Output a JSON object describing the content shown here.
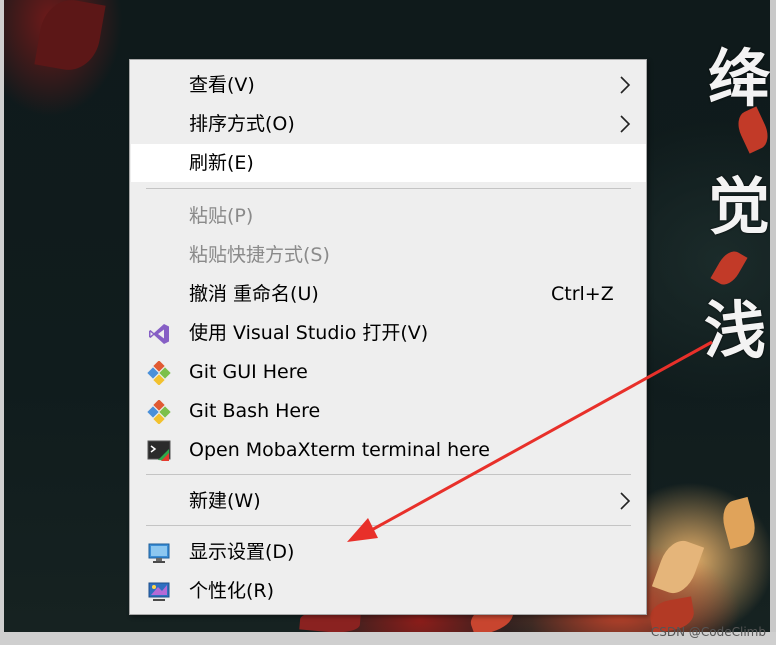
{
  "wallpaper": {
    "characters": [
      "绛",
      "觉",
      "浅"
    ],
    "colors": {
      "dark": "#101c1d",
      "accent_red": "#c4442b",
      "accent_gold": "#e7b16a"
    }
  },
  "context_menu": {
    "items": [
      {
        "label": "查看(V)",
        "submenu": true
      },
      {
        "label": "排序方式(O)",
        "submenu": true
      },
      {
        "label": "刷新(E)",
        "highlighted": true
      },
      {
        "label": "粘贴(P)",
        "disabled": true
      },
      {
        "label": "粘贴快捷方式(S)",
        "disabled": true
      },
      {
        "label": "撤消 重命名(U)",
        "shortcut": "Ctrl+Z"
      },
      {
        "label": "使用 Visual Studio 打开(V)",
        "icon": "visual-studio-icon"
      },
      {
        "label": "Git GUI Here",
        "icon": "git-icon"
      },
      {
        "label": "Git Bash Here",
        "icon": "git-icon"
      },
      {
        "label": "Open MobaXterm terminal here",
        "icon": "mobaxterm-icon"
      },
      {
        "label": "新建(W)",
        "submenu": true
      },
      {
        "label": "显示设置(D)",
        "icon": "display-settings-icon"
      },
      {
        "label": "个性化(R)",
        "icon": "personalize-icon"
      }
    ],
    "chevron": "›"
  },
  "annotation": {
    "arrow_color": "#e8302a"
  },
  "watermark": "CSDN @CodeClimb"
}
